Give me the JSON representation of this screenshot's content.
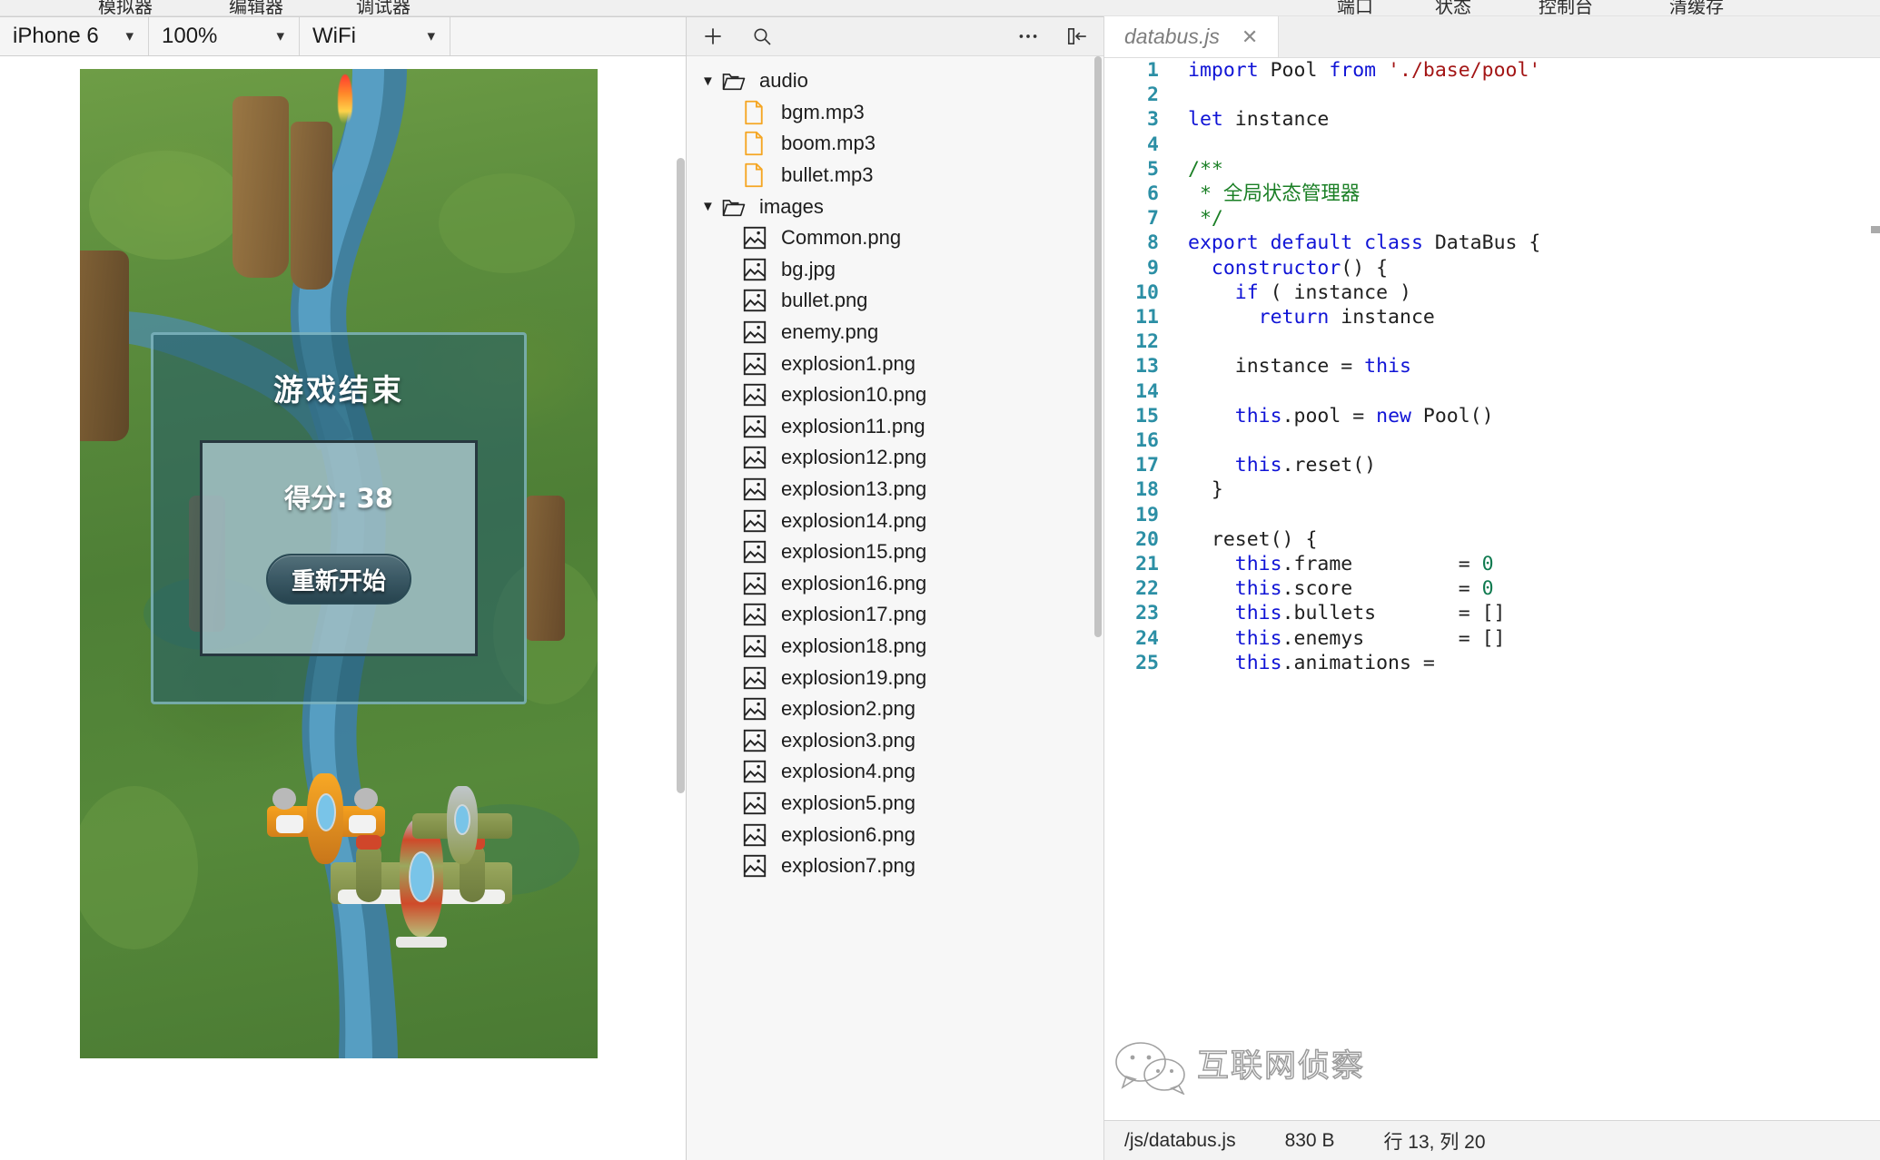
{
  "menu": {
    "items_left": [
      "模拟器",
      "编辑器",
      "调试器"
    ],
    "items_right": [
      "端口",
      "状态",
      "控制台",
      "清缓存"
    ]
  },
  "simulator": {
    "device": {
      "value": "iPhone 6",
      "icon": "chevron-down-icon"
    },
    "zoom": {
      "value": "100%",
      "icon": "chevron-down-icon"
    },
    "network": {
      "value": "WiFi",
      "icon": "chevron-down-icon"
    },
    "game": {
      "dialog_title": "游戏结束",
      "score_label": "得分: 38",
      "restart_label": "重新开始"
    }
  },
  "explorer": {
    "toolbar": {
      "add": "+",
      "search_icon": "search-icon",
      "more_icon": "more-horizontal-icon",
      "collapse_icon": "collapse-panel-icon"
    },
    "tree": [
      {
        "type": "folder",
        "name": "audio",
        "expanded": true,
        "caret": "▼",
        "icon": "folder-open-icon"
      },
      {
        "type": "file",
        "name": "bgm.mp3",
        "icon": "audio-file-icon"
      },
      {
        "type": "file",
        "name": "boom.mp3",
        "icon": "audio-file-icon"
      },
      {
        "type": "file",
        "name": "bullet.mp3",
        "icon": "audio-file-icon"
      },
      {
        "type": "folder",
        "name": "images",
        "expanded": true,
        "caret": "▼",
        "icon": "folder-open-icon"
      },
      {
        "type": "file",
        "name": "Common.png",
        "icon": "image-file-icon"
      },
      {
        "type": "file",
        "name": "bg.jpg",
        "icon": "image-file-icon"
      },
      {
        "type": "file",
        "name": "bullet.png",
        "icon": "image-file-icon"
      },
      {
        "type": "file",
        "name": "enemy.png",
        "icon": "image-file-icon"
      },
      {
        "type": "file",
        "name": "explosion1.png",
        "icon": "image-file-icon"
      },
      {
        "type": "file",
        "name": "explosion10.png",
        "icon": "image-file-icon"
      },
      {
        "type": "file",
        "name": "explosion11.png",
        "icon": "image-file-icon"
      },
      {
        "type": "file",
        "name": "explosion12.png",
        "icon": "image-file-icon"
      },
      {
        "type": "file",
        "name": "explosion13.png",
        "icon": "image-file-icon"
      },
      {
        "type": "file",
        "name": "explosion14.png",
        "icon": "image-file-icon"
      },
      {
        "type": "file",
        "name": "explosion15.png",
        "icon": "image-file-icon"
      },
      {
        "type": "file",
        "name": "explosion16.png",
        "icon": "image-file-icon"
      },
      {
        "type": "file",
        "name": "explosion17.png",
        "icon": "image-file-icon"
      },
      {
        "type": "file",
        "name": "explosion18.png",
        "icon": "image-file-icon"
      },
      {
        "type": "file",
        "name": "explosion19.png",
        "icon": "image-file-icon"
      },
      {
        "type": "file",
        "name": "explosion2.png",
        "icon": "image-file-icon"
      },
      {
        "type": "file",
        "name": "explosion3.png",
        "icon": "image-file-icon"
      },
      {
        "type": "file",
        "name": "explosion4.png",
        "icon": "image-file-icon"
      },
      {
        "type": "file",
        "name": "explosion5.png",
        "icon": "image-file-icon"
      },
      {
        "type": "file",
        "name": "explosion6.png",
        "icon": "image-file-icon"
      },
      {
        "type": "file",
        "name": "explosion7.png",
        "icon": "image-file-icon"
      }
    ]
  },
  "editor": {
    "tab": {
      "name": "databus.js",
      "close_icon": "close-icon"
    },
    "lines": [
      {
        "n": "1",
        "tokens": [
          {
            "t": "import ",
            "c": "kw"
          },
          {
            "t": "Pool ",
            "c": ""
          },
          {
            "t": "from ",
            "c": "kw"
          },
          {
            "t": "'./base/pool'",
            "c": "str"
          }
        ]
      },
      {
        "n": "2",
        "tokens": []
      },
      {
        "n": "3",
        "tokens": [
          {
            "t": "let ",
            "c": "kw"
          },
          {
            "t": "instance",
            "c": ""
          }
        ]
      },
      {
        "n": "4",
        "tokens": []
      },
      {
        "n": "5",
        "tokens": [
          {
            "t": "/**",
            "c": "cmt"
          }
        ]
      },
      {
        "n": "6",
        "tokens": [
          {
            "t": " * 全局状态管理器",
            "c": "cmt"
          }
        ]
      },
      {
        "n": "7",
        "tokens": [
          {
            "t": " */",
            "c": "cmt"
          }
        ]
      },
      {
        "n": "8",
        "tokens": [
          {
            "t": "export ",
            "c": "kw"
          },
          {
            "t": "default ",
            "c": "kw"
          },
          {
            "t": "class ",
            "c": "kw"
          },
          {
            "t": "DataBus {",
            "c": ""
          }
        ]
      },
      {
        "n": "9",
        "tokens": [
          {
            "t": "  ",
            "c": ""
          },
          {
            "t": "constructor",
            "c": "kw"
          },
          {
            "t": "() {",
            "c": ""
          }
        ]
      },
      {
        "n": "10",
        "tokens": [
          {
            "t": "    ",
            "c": ""
          },
          {
            "t": "if ",
            "c": "kw"
          },
          {
            "t": "( instance )",
            "c": ""
          }
        ]
      },
      {
        "n": "11",
        "tokens": [
          {
            "t": "      ",
            "c": ""
          },
          {
            "t": "return ",
            "c": "kw"
          },
          {
            "t": "instance",
            "c": ""
          }
        ]
      },
      {
        "n": "12",
        "tokens": []
      },
      {
        "n": "13",
        "tokens": [
          {
            "t": "    instance = ",
            "c": ""
          },
          {
            "t": "this",
            "c": "kw"
          }
        ]
      },
      {
        "n": "14",
        "tokens": []
      },
      {
        "n": "15",
        "tokens": [
          {
            "t": "    ",
            "c": ""
          },
          {
            "t": "this",
            "c": "kw"
          },
          {
            "t": ".pool = ",
            "c": ""
          },
          {
            "t": "new ",
            "c": "kw"
          },
          {
            "t": "Pool()",
            "c": ""
          }
        ]
      },
      {
        "n": "16",
        "tokens": []
      },
      {
        "n": "17",
        "tokens": [
          {
            "t": "    ",
            "c": ""
          },
          {
            "t": "this",
            "c": "kw"
          },
          {
            "t": ".reset()",
            "c": ""
          }
        ]
      },
      {
        "n": "18",
        "tokens": [
          {
            "t": "  }",
            "c": ""
          }
        ]
      },
      {
        "n": "19",
        "tokens": []
      },
      {
        "n": "20",
        "tokens": [
          {
            "t": "  reset() {",
            "c": ""
          }
        ]
      },
      {
        "n": "21",
        "tokens": [
          {
            "t": "    ",
            "c": ""
          },
          {
            "t": "this",
            "c": "kw"
          },
          {
            "t": ".frame         = ",
            "c": ""
          },
          {
            "t": "0",
            "c": "num"
          }
        ]
      },
      {
        "n": "22",
        "tokens": [
          {
            "t": "    ",
            "c": ""
          },
          {
            "t": "this",
            "c": "kw"
          },
          {
            "t": ".score         = ",
            "c": ""
          },
          {
            "t": "0",
            "c": "num"
          }
        ]
      },
      {
        "n": "23",
        "tokens": [
          {
            "t": "    ",
            "c": ""
          },
          {
            "t": "this",
            "c": "kw"
          },
          {
            "t": ".bullets       = []",
            "c": ""
          }
        ]
      },
      {
        "n": "24",
        "tokens": [
          {
            "t": "    ",
            "c": ""
          },
          {
            "t": "this",
            "c": "kw"
          },
          {
            "t": ".enemys        = []",
            "c": ""
          }
        ]
      },
      {
        "n": "25",
        "tokens": [
          {
            "t": "    ",
            "c": ""
          },
          {
            "t": "this",
            "c": "kw"
          },
          {
            "t": ".animations = ",
            "c": ""
          }
        ]
      }
    ],
    "watermark": "互联网侦察",
    "status": {
      "path": "/js/databus.js",
      "size": "830 B",
      "cursor": "行 13, 列 20"
    }
  }
}
